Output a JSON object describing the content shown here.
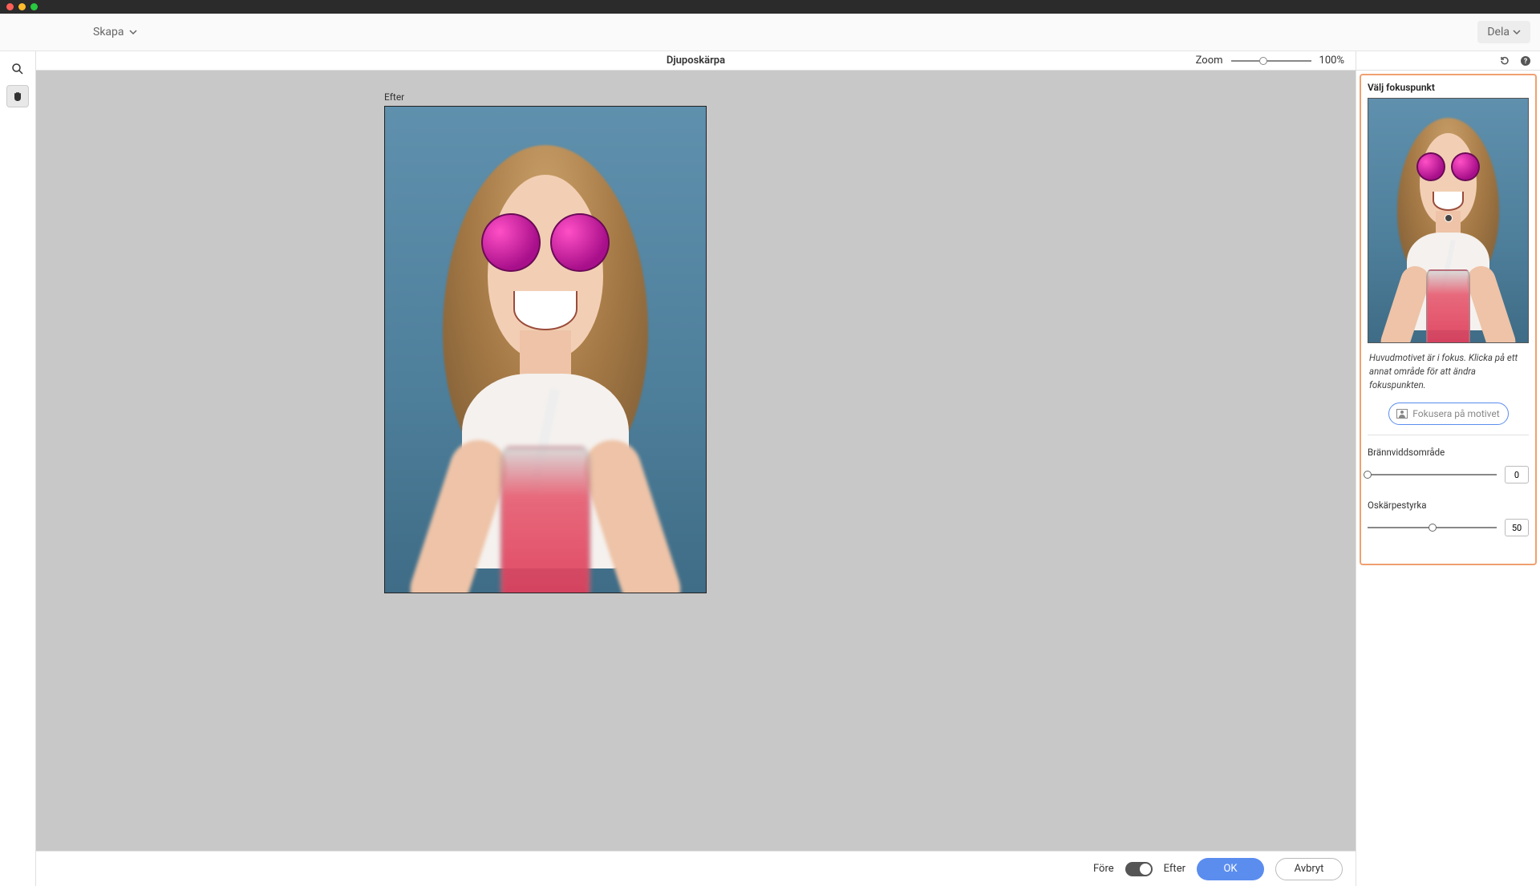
{
  "window": {
    "menu_create": "Skapa",
    "share": "Dela"
  },
  "workspace": {
    "title": "Djuposkärpa",
    "zoom_label": "Zoom",
    "zoom_value": "100%"
  },
  "preview": {
    "label": "Efter"
  },
  "panel": {
    "focus_title": "Välj fokuspunkt",
    "hint": "Huvudmotivet är i fokus. Klicka på ett annat område för att ändra fokuspunkten.",
    "focus_button": "Fokusera på motivet",
    "sliders": {
      "focal_range": {
        "label": "Brännviddsområde",
        "value": "0",
        "percent": 0
      },
      "blur_strength": {
        "label": "Oskärpestyrka",
        "value": "50",
        "percent": 50
      }
    }
  },
  "footer": {
    "before": "Före",
    "after": "Efter",
    "ok": "OK",
    "cancel": "Avbryt"
  }
}
